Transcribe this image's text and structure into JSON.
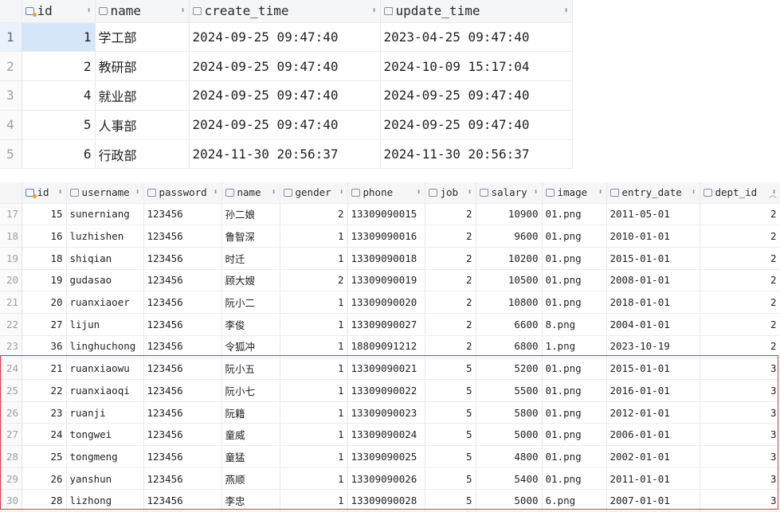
{
  "dept_table": {
    "columns": [
      {
        "key": "id",
        "label": "id",
        "icon": "primary-key-icon"
      },
      {
        "key": "name",
        "label": "name",
        "icon": "column-icon"
      },
      {
        "key": "create_time",
        "label": "create_time",
        "icon": "column-icon"
      },
      {
        "key": "update_time",
        "label": "update_time",
        "icon": "column-icon"
      }
    ],
    "rows": [
      {
        "rn": "1",
        "id": "1",
        "name": "学工部",
        "create_time": "2024-09-25 09:47:40",
        "update_time": "2023-04-25 09:47:40"
      },
      {
        "rn": "2",
        "id": "2",
        "name": "教研部",
        "create_time": "2024-09-25 09:47:40",
        "update_time": "2024-10-09 15:17:04"
      },
      {
        "rn": "3",
        "id": "4",
        "name": "就业部",
        "create_time": "2024-09-25 09:47:40",
        "update_time": "2024-09-25 09:47:40"
      },
      {
        "rn": "4",
        "id": "5",
        "name": "人事部",
        "create_time": "2024-09-25 09:47:40",
        "update_time": "2024-09-25 09:47:40"
      },
      {
        "rn": "5",
        "id": "6",
        "name": "行政部",
        "create_time": "2024-11-30 20:56:37",
        "update_time": "2024-11-30 20:56:37"
      }
    ]
  },
  "emp_table": {
    "columns": [
      {
        "key": "id",
        "label": "id",
        "icon": "primary-key-icon"
      },
      {
        "key": "username",
        "label": "username",
        "icon": "column-icon"
      },
      {
        "key": "password",
        "label": "password",
        "icon": "column-icon"
      },
      {
        "key": "name",
        "label": "name",
        "icon": "column-icon"
      },
      {
        "key": "gender",
        "label": "gender",
        "icon": "column-icon"
      },
      {
        "key": "phone",
        "label": "phone",
        "icon": "column-icon"
      },
      {
        "key": "job",
        "label": "job",
        "icon": "column-icon"
      },
      {
        "key": "salary",
        "label": "salary",
        "icon": "column-icon"
      },
      {
        "key": "image",
        "label": "image",
        "icon": "column-icon"
      },
      {
        "key": "entry_date",
        "label": "entry_date",
        "icon": "column-icon"
      },
      {
        "key": "dept_id",
        "label": "dept_id",
        "icon": "column-icon"
      }
    ],
    "rows": [
      {
        "rn": "17",
        "id": "15",
        "username": "sunerniang",
        "password": "123456",
        "name": "孙二娘",
        "gender": "2",
        "phone": "13309090015",
        "job": "2",
        "salary": "10900",
        "image": "01.png",
        "entry_date": "2011-05-01",
        "dept_id": "2"
      },
      {
        "rn": "18",
        "id": "16",
        "username": "luzhishen",
        "password": "123456",
        "name": "鲁智深",
        "gender": "1",
        "phone": "13309090016",
        "job": "2",
        "salary": "9600",
        "image": "01.png",
        "entry_date": "2010-01-01",
        "dept_id": "2"
      },
      {
        "rn": "19",
        "id": "18",
        "username": "shiqian",
        "password": "123456",
        "name": "时迁",
        "gender": "1",
        "phone": "13309090018",
        "job": "2",
        "salary": "10200",
        "image": "01.png",
        "entry_date": "2015-01-01",
        "dept_id": "2"
      },
      {
        "rn": "20",
        "id": "19",
        "username": "gudasao",
        "password": "123456",
        "name": "顾大嫂",
        "gender": "2",
        "phone": "13309090019",
        "job": "2",
        "salary": "10500",
        "image": "01.png",
        "entry_date": "2008-01-01",
        "dept_id": "2"
      },
      {
        "rn": "21",
        "id": "20",
        "username": "ruanxiaoer",
        "password": "123456",
        "name": "阮小二",
        "gender": "1",
        "phone": "13309090020",
        "job": "2",
        "salary": "10800",
        "image": "01.png",
        "entry_date": "2018-01-01",
        "dept_id": "2"
      },
      {
        "rn": "22",
        "id": "27",
        "username": "lijun",
        "password": "123456",
        "name": "李俊",
        "gender": "1",
        "phone": "13309090027",
        "job": "2",
        "salary": "6600",
        "image": "8.png",
        "entry_date": "2004-01-01",
        "dept_id": "2"
      },
      {
        "rn": "23",
        "id": "36",
        "username": "linghuchong",
        "password": "123456",
        "name": "令狐冲",
        "gender": "1",
        "phone": "18809091212",
        "job": "2",
        "salary": "6800",
        "image": "1.png",
        "entry_date": "2023-10-19",
        "dept_id": "2"
      },
      {
        "rn": "24",
        "id": "21",
        "username": "ruanxiaowu",
        "password": "123456",
        "name": "阮小五",
        "gender": "1",
        "phone": "13309090021",
        "job": "5",
        "salary": "5200",
        "image": "01.png",
        "entry_date": "2015-01-01",
        "dept_id": "3"
      },
      {
        "rn": "25",
        "id": "22",
        "username": "ruanxiaoqi",
        "password": "123456",
        "name": "阮小七",
        "gender": "1",
        "phone": "13309090022",
        "job": "5",
        "salary": "5500",
        "image": "01.png",
        "entry_date": "2016-01-01",
        "dept_id": "3"
      },
      {
        "rn": "26",
        "id": "23",
        "username": "ruanji",
        "password": "123456",
        "name": "阮籍",
        "gender": "1",
        "phone": "13309090023",
        "job": "5",
        "salary": "5800",
        "image": "01.png",
        "entry_date": "2012-01-01",
        "dept_id": "3"
      },
      {
        "rn": "27",
        "id": "24",
        "username": "tongwei",
        "password": "123456",
        "name": "童威",
        "gender": "1",
        "phone": "13309090024",
        "job": "5",
        "salary": "5000",
        "image": "01.png",
        "entry_date": "2006-01-01",
        "dept_id": "3"
      },
      {
        "rn": "28",
        "id": "25",
        "username": "tongmeng",
        "password": "123456",
        "name": "童猛",
        "gender": "1",
        "phone": "13309090025",
        "job": "5",
        "salary": "4800",
        "image": "01.png",
        "entry_date": "2002-01-01",
        "dept_id": "3"
      },
      {
        "rn": "29",
        "id": "26",
        "username": "yanshun",
        "password": "123456",
        "name": "燕顺",
        "gender": "1",
        "phone": "13309090026",
        "job": "5",
        "salary": "5400",
        "image": "01.png",
        "entry_date": "2011-01-01",
        "dept_id": "3"
      },
      {
        "rn": "30",
        "id": "28",
        "username": "lizhong",
        "password": "123456",
        "name": "李忠",
        "gender": "1",
        "phone": "13309090028",
        "job": "5",
        "salary": "5000",
        "image": "6.png",
        "entry_date": "2007-01-01",
        "dept_id": "3"
      }
    ]
  },
  "colors": {
    "selection": "#d5e6fb",
    "highlight_border": "#d9363e"
  },
  "icons": {
    "sort": "sort-arrows-icon",
    "scroll": "scroll-up-caret-icon"
  }
}
